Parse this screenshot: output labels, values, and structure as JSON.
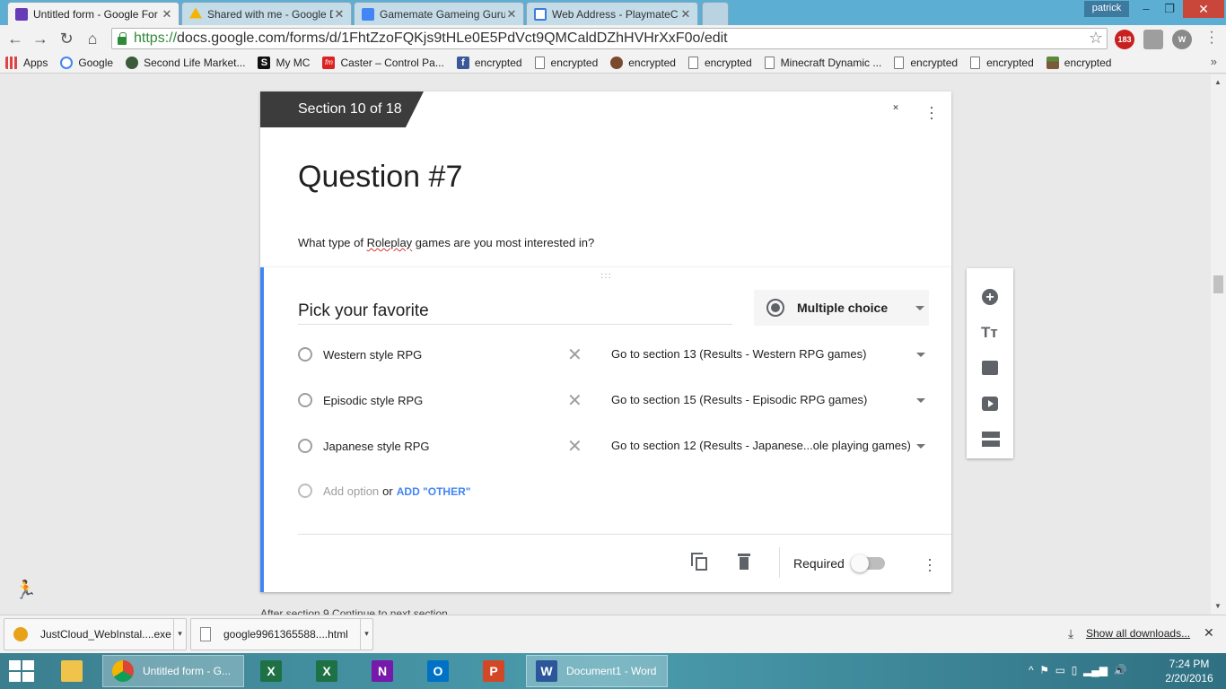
{
  "browser": {
    "tabs": [
      {
        "title": "Untitled form - Google For",
        "color": "#673ab7"
      },
      {
        "title": "Shared with me - Google D",
        "color": "#f4b400"
      },
      {
        "title": "Gamemate Gameing Guru",
        "color": "#4285f4"
      },
      {
        "title": "Web Address - PlaymateC",
        "color": "#3b7dd8"
      }
    ],
    "user": "patrick",
    "url_scheme": "https://",
    "url_rest": "docs.google.com/forms/d/1FhtZzoFQKjs9tHLe0E5PdVct9QMCaldDZhHVHrXxF0o/edit",
    "extensions": {
      "abp_badge": "183"
    },
    "bookmarks": [
      {
        "label": "Apps",
        "icon": "apps-grid-icon"
      },
      {
        "label": "Google",
        "icon": "google-icon"
      },
      {
        "label": "Second Life Market...",
        "icon": "hand-icon"
      },
      {
        "label": "My MC",
        "icon": "s-icon"
      },
      {
        "label": "Caster – Control Pa...",
        "icon": "fm-icon"
      },
      {
        "label": "encrypted",
        "icon": "facebook-icon"
      },
      {
        "label": "encrypted",
        "icon": "doc-icon"
      },
      {
        "label": "encrypted",
        "icon": "avatar-icon"
      },
      {
        "label": "encrypted",
        "icon": "doc-icon"
      },
      {
        "label": "Minecraft Dynamic ...",
        "icon": "doc-icon"
      },
      {
        "label": "encrypted",
        "icon": "doc-icon"
      },
      {
        "label": "encrypted",
        "icon": "doc-icon"
      },
      {
        "label": "encrypted",
        "icon": "block-icon"
      }
    ]
  },
  "section": {
    "tag": "Section 10 of 18",
    "title": "Question #7",
    "desc_before": "What type of ",
    "desc_misspelled": "Roleplay",
    "desc_after": " games are you most interested in?"
  },
  "question": {
    "title": "Pick your favorite",
    "type": "Multiple choice",
    "options": [
      {
        "label": "Western style RPG",
        "goto": "Go to section 13 (Results - Western RPG games)"
      },
      {
        "label": "Episodic style RPG",
        "goto": "Go to section 15 (Results - Episodic RPG games)"
      },
      {
        "label": "Japanese style RPG",
        "goto": "Go to section 12 (Results - Japanese...ole playing games)"
      }
    ],
    "add_option": "Add option",
    "or": "or",
    "add_other": "ADD \"OTHER\"",
    "required_label": "Required",
    "required": false
  },
  "below_text": "After section 9   Continue to next section",
  "downloads": {
    "items": [
      "JustCloud_WebInstal....exe",
      "google9961365588....html"
    ],
    "show_all": "Show all downloads..."
  },
  "taskbar": {
    "apps": [
      {
        "label": "",
        "icon": "file-explorer-icon"
      },
      {
        "label": "Untitled form - G...",
        "icon": "chrome-icon"
      },
      {
        "label": "",
        "icon": "excel-icon"
      },
      {
        "label": "",
        "icon": "onenote-icon"
      },
      {
        "label": "",
        "icon": "outlook-icon"
      },
      {
        "label": "",
        "icon": "powerpoint-icon"
      },
      {
        "label": "Document1 - Word",
        "icon": "word-icon"
      }
    ],
    "time": "7:24 PM",
    "date": "2/20/2016"
  }
}
